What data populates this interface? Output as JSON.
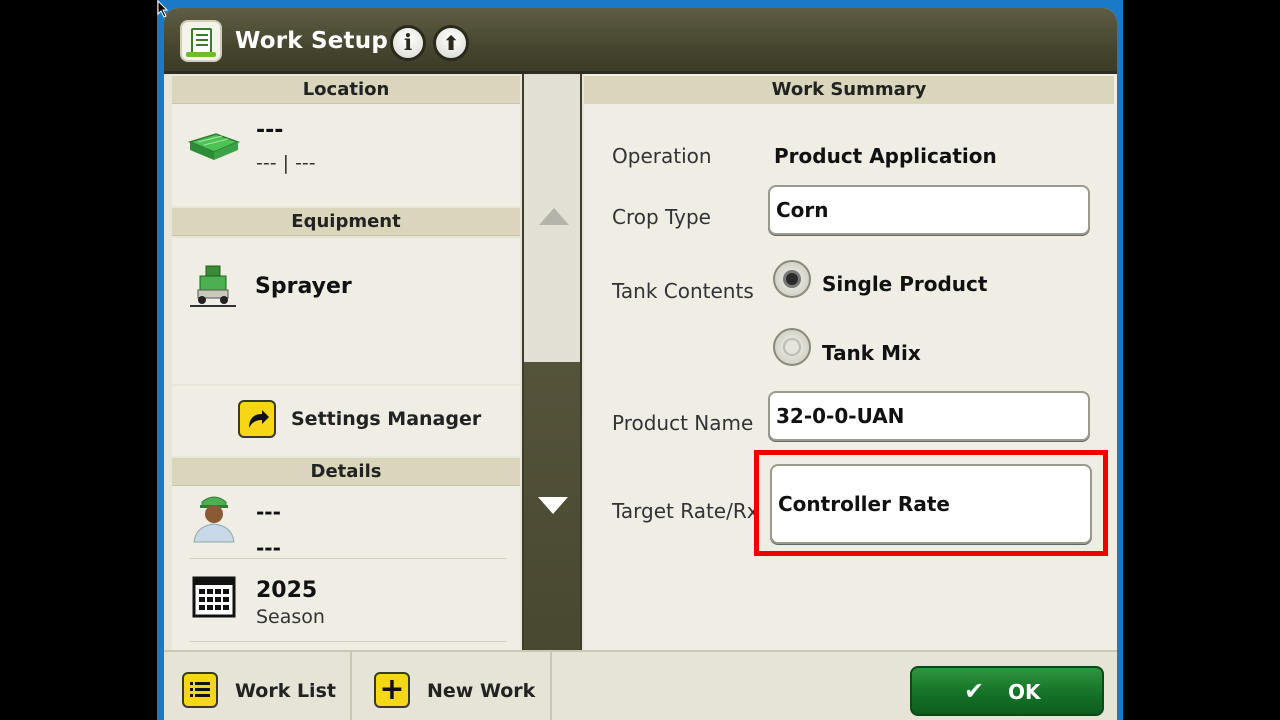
{
  "window": {
    "title": "Work Setup"
  },
  "header_buttons": {
    "info_glyph": "i",
    "upload_glyph": "⬆"
  },
  "location": {
    "heading": "Location",
    "name": "---",
    "detail_left": "---",
    "detail_sep": "|",
    "detail_right": "---"
  },
  "equipment": {
    "heading": "Equipment",
    "name": "Sprayer"
  },
  "settings_manager": {
    "label": "Settings Manager"
  },
  "details": {
    "heading": "Details",
    "operator_line1": "---",
    "operator_line2": "---",
    "season_year": "2025",
    "season_label": "Season"
  },
  "work_summary": {
    "heading": "Work Summary",
    "operation_label": "Operation",
    "operation_value": "Product Application",
    "crop_type_label": "Crop Type",
    "crop_type_value": "Corn",
    "tank_contents_label": "Tank Contents",
    "tank_options": [
      "Single Product",
      "Tank Mix"
    ],
    "tank_selected": "Single Product",
    "product_name_label": "Product Name",
    "product_name_value": "32-0-0-UAN",
    "target_rate_label": "Target Rate/Rx",
    "target_rate_value": "Controller Rate"
  },
  "bottom_bar": {
    "work_list_label": "Work List",
    "new_work_label": "New Work",
    "ok_label": "OK",
    "ok_check": "✔",
    "new_work_glyph": "+"
  },
  "colors": {
    "highlight": "#ee0000",
    "title_bar": "#47462f",
    "ok_green": "#157327",
    "accent_yellow": "#f5d716"
  }
}
